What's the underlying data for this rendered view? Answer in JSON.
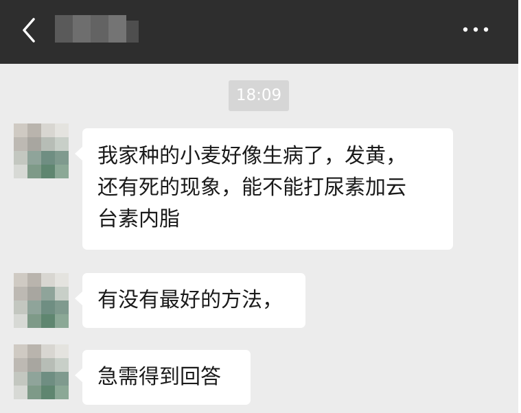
{
  "header": {
    "back_icon": "chevron-left-icon",
    "contact_name": "",
    "more_icon": "more-horizontal-icon",
    "bar_color": "#2e2e2e"
  },
  "chat": {
    "timestamp": "18:09",
    "messages": [
      {
        "sender": "contact",
        "lines": [
          "我家种的小麦好像生病了，发黄，",
          "还有死的现象，能不能打尿素加云",
          "台素内脂"
        ]
      },
      {
        "sender": "contact",
        "lines": [
          "有没有最好的方法，"
        ]
      },
      {
        "sender": "contact",
        "lines": [
          "急需得到回答"
        ]
      }
    ]
  },
  "colors": {
    "background": "#ececec",
    "bubble": "#ffffff",
    "timestamp_bg": "#d6d6d6"
  }
}
